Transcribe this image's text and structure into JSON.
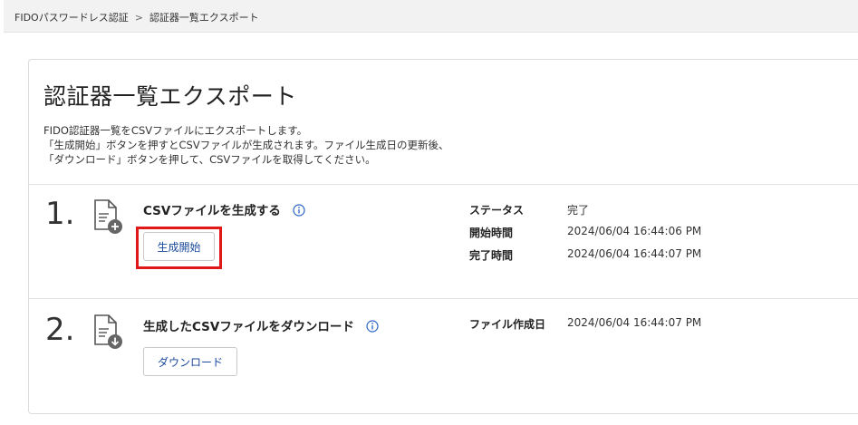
{
  "breadcrumb": {
    "items": [
      "FIDOパスワードレス認証",
      "認証器一覧エクスポート"
    ],
    "separator": ">"
  },
  "page": {
    "title": "認証器一覧エクスポート",
    "description": [
      "FIDO認証器一覧をCSVファイルにエクスポートします。",
      "「生成開始」ボタンを押すとCSVファイルが生成されます。ファイル生成日の更新後、",
      "「ダウンロード」ボタンを押して、CSVファイルを取得してください。"
    ]
  },
  "steps": [
    {
      "number": "1.",
      "title": "CSVファイルを生成する",
      "button_label": "生成開始",
      "icon": "document-add-icon",
      "status": [
        {
          "key": "ステータス",
          "value": "完了"
        },
        {
          "key": "開始時間",
          "value": "2024/06/04 16:44:06 PM"
        },
        {
          "key": "完了時間",
          "value": "2024/06/04 16:44:07 PM"
        }
      ]
    },
    {
      "number": "2.",
      "title": "生成したCSVファイルをダウンロード",
      "button_label": "ダウンロード",
      "icon": "document-download-icon",
      "status": [
        {
          "key": "ファイル作成日",
          "value": "2024/06/04 16:44:07 PM"
        }
      ]
    }
  ],
  "colors": {
    "accent": "#1a4a9a",
    "highlight": "#e01818",
    "info_icon": "#2b63c5"
  }
}
